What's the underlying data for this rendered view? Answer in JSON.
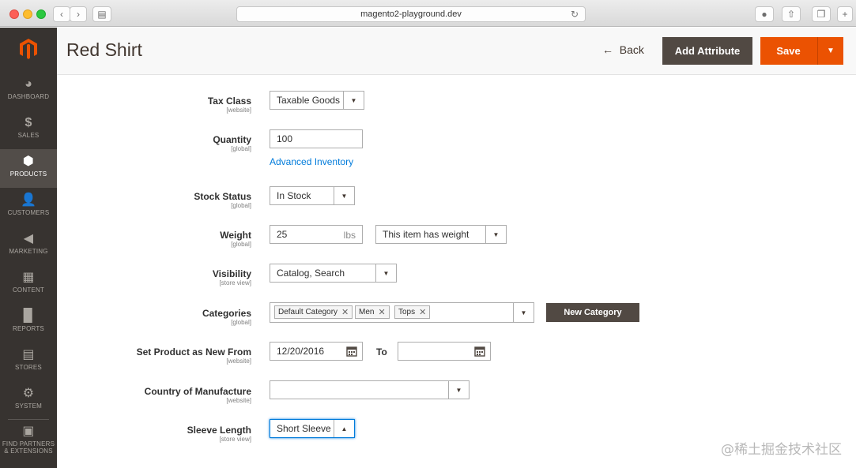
{
  "browser": {
    "url": "magento2-playground.dev"
  },
  "sidebar": {
    "items": [
      {
        "label": "DASHBOARD",
        "icon": "dashboard-icon"
      },
      {
        "label": "SALES",
        "icon": "dollar-icon"
      },
      {
        "label": "PRODUCTS",
        "icon": "cube-icon"
      },
      {
        "label": "CUSTOMERS",
        "icon": "person-icon"
      },
      {
        "label": "MARKETING",
        "icon": "megaphone-icon"
      },
      {
        "label": "CONTENT",
        "icon": "layout-icon"
      },
      {
        "label": "REPORTS",
        "icon": "bar-chart-icon"
      },
      {
        "label": "STORES",
        "icon": "store-icon"
      },
      {
        "label": "SYSTEM",
        "icon": "gear-icon"
      },
      {
        "label_1": "FIND PARTNERS",
        "label_2": "& EXTENSIONS",
        "icon": "box-icon"
      }
    ],
    "active": "PRODUCTS"
  },
  "header": {
    "title": "Red Shirt",
    "back": "Back",
    "add_attribute": "Add Attribute",
    "save": "Save"
  },
  "form": {
    "tax_class": {
      "label": "Tax Class",
      "scope": "[website]",
      "value": "Taxable Goods"
    },
    "quantity": {
      "label": "Quantity",
      "scope": "[global]",
      "value": "100",
      "link": "Advanced Inventory"
    },
    "stock_status": {
      "label": "Stock Status",
      "scope": "[global]",
      "value": "In Stock"
    },
    "weight": {
      "label": "Weight",
      "scope": "[global]",
      "value": "25",
      "unit": "lbs",
      "type": "This item has weight"
    },
    "visibility": {
      "label": "Visibility",
      "scope": "[store view]",
      "value": "Catalog, Search"
    },
    "categories": {
      "label": "Categories",
      "scope": "[global]",
      "tags": [
        "Default Category",
        "Men",
        "Tops"
      ],
      "new_button": "New Category"
    },
    "new_from": {
      "label": "Set Product as New From",
      "scope": "[website]",
      "from": "12/20/2016",
      "to_label": "To",
      "to": ""
    },
    "country": {
      "label": "Country of Manufacture",
      "scope": "[website]",
      "value": ""
    },
    "sleeve": {
      "label": "Sleeve Length",
      "scope": "[store view]",
      "value": "Short Sleeve"
    }
  },
  "watermark": "@稀土掘金技术社区",
  "colors": {
    "accent": "#eb5202",
    "sidebar": "#373330",
    "link": "#007bdb",
    "dark_button": "#514943"
  }
}
